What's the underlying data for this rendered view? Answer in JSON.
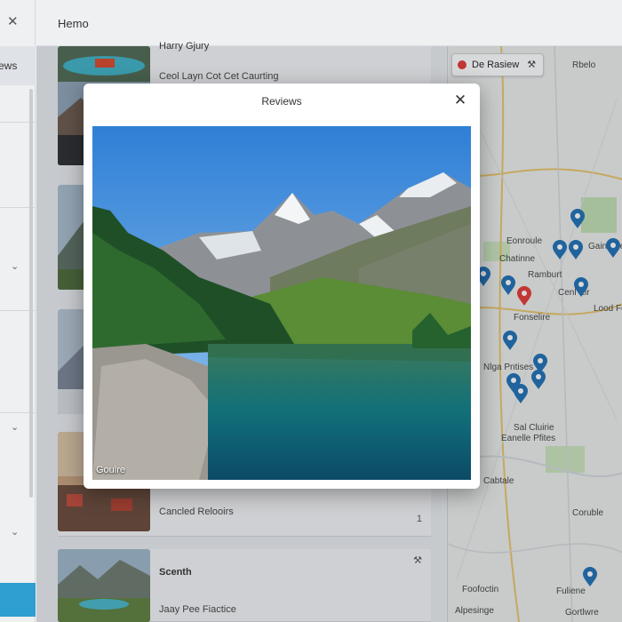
{
  "window": {
    "close_glyph": "✕",
    "title": "Hemo"
  },
  "sidebar": {
    "tab_label": "ews",
    "chevrons": [
      "⌄",
      "⌄",
      "⌄"
    ]
  },
  "results": [
    {
      "title": "Harry Gjury",
      "subtitle": "Ceol Layn Cot Cet Caurting",
      "mark": ""
    },
    {
      "title": "",
      "subtitle": "",
      "mark": ""
    },
    {
      "title": "",
      "subtitle": "",
      "mark": ""
    },
    {
      "title": "",
      "subtitle": "Cancled Relooirs",
      "mark": "1"
    },
    {
      "title": "Scenth",
      "subtitle": "Jaay Pee Fiactice",
      "mark": "⚒"
    }
  ],
  "map": {
    "chip_label": "De Rasiew",
    "chip_close": "⚒",
    "labels": [
      "Rbelo",
      "Eonroule",
      "Gaind Fe",
      "Chatinne",
      "Ramburt",
      "Cenl Eir",
      "Fonselire",
      "Lood Fo",
      "Nlga Pntises",
      "Sal Cluirie",
      "Eanelle Pfites",
      "Cabtale",
      "Coruble",
      "Foofoctin",
      "Fuliene",
      "Alpesinge",
      "Gortlwre"
    ]
  },
  "modal": {
    "title": "Reviews",
    "close_glyph": "✕",
    "photo_caption": "Goulre"
  },
  "colors": {
    "accent": "#2f9ed1",
    "pin_blue": "#1f6fb5",
    "pin_red": "#e53935"
  }
}
